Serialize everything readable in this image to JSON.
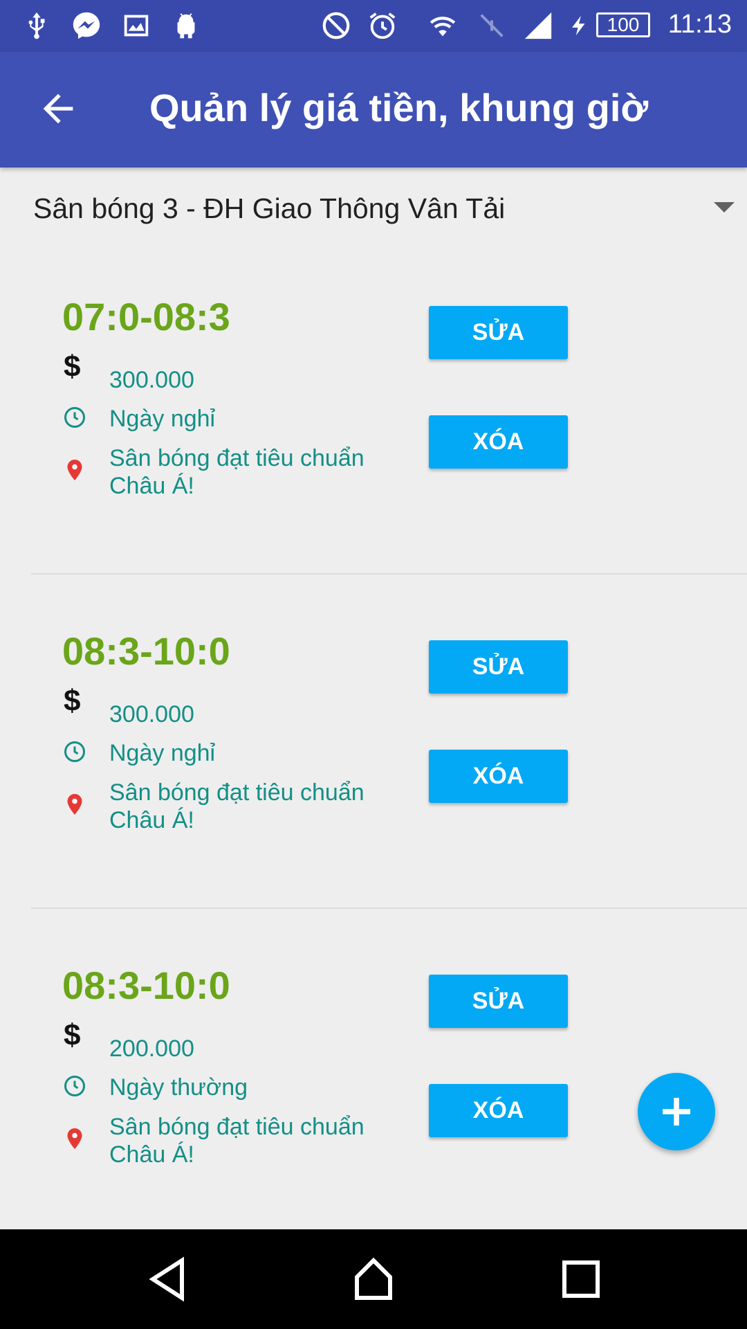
{
  "status_bar": {
    "battery": "100",
    "time": "11:13",
    "icons": [
      "usb-icon",
      "messenger-icon",
      "image-icon",
      "android-icon",
      "no-disturb-icon",
      "alarm-icon",
      "wifi-icon",
      "no-signal-icon",
      "signal-icon",
      "charging-icon",
      "battery-icon"
    ]
  },
  "app_bar": {
    "title": "Quản lý giá tiền, khung giờ",
    "back_icon": "arrow-back-icon"
  },
  "spinner": {
    "selected": "Sân bóng 3 - ĐH Giao Thông Vân Tải"
  },
  "items": [
    {
      "time_range": "07:0-08:3",
      "price": "300.000",
      "day_type": "Ngày nghỉ",
      "description_line1": "Sân bóng đạt tiêu chuẩn",
      "description_line2": "Châu Á!",
      "edit_label": "SỬA",
      "delete_label": "XÓA"
    },
    {
      "time_range": "08:3-10:0",
      "price": "300.000",
      "day_type": "Ngày nghỉ",
      "description_line1": "Sân bóng đạt tiêu chuẩn",
      "description_line2": "Châu Á!",
      "edit_label": "SỬA",
      "delete_label": "XÓA"
    },
    {
      "time_range": "08:3-10:0",
      "price": "200.000",
      "day_type": "Ngày thường",
      "description_line1": "Sân bóng đạt tiêu chuẩn",
      "description_line2": "Châu Á!",
      "edit_label": "SỬA",
      "delete_label": "XÓA"
    }
  ],
  "price_symbol": "$",
  "fab_icon": "plus-icon",
  "colors": {
    "status_bar": "#3949ab",
    "app_bar": "#3f51b5",
    "time_range": "#6aa51a",
    "info_text": "#138f86",
    "button": "#03a9f4",
    "pin": "#e53935"
  },
  "nav_bar": [
    "back-triangle-icon",
    "home-icon",
    "recents-icon"
  ]
}
